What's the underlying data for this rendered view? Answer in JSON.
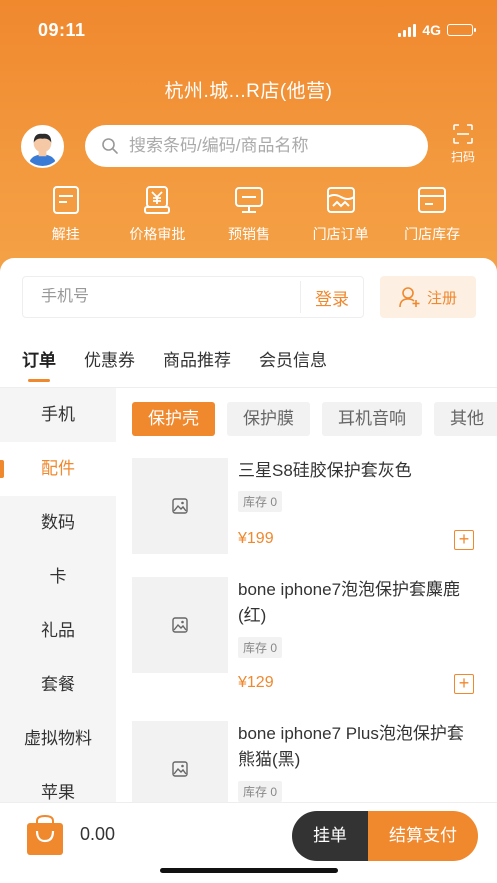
{
  "status_bar": {
    "time": "09:11",
    "network": "4G"
  },
  "header": {
    "store_name": "杭州.城...R店(他营)",
    "search_placeholder": "搜索条码/编码/商品名称",
    "scan_label": "扫码",
    "quick_actions": [
      {
        "label": "解挂",
        "icon": "document-icon"
      },
      {
        "label": "价格审批",
        "icon": "price-approval-icon"
      },
      {
        "label": "预销售",
        "icon": "monitor-icon"
      },
      {
        "label": "门店订单",
        "icon": "store-order-icon"
      },
      {
        "label": "门店库存",
        "icon": "store-stock-icon"
      }
    ]
  },
  "login": {
    "phone_placeholder": "手机号",
    "login_label": "登录",
    "register_label": "注册"
  },
  "tabs": [
    "订单",
    "优惠券",
    "商品推荐",
    "会员信息"
  ],
  "active_tab": "订单",
  "categories": [
    "手机",
    "配件",
    "数码",
    "卡",
    "礼品",
    "套餐",
    "虚拟物料",
    "苹果"
  ],
  "active_category": "配件",
  "subcategories": [
    "保护壳",
    "保护膜",
    "耳机音响",
    "其他"
  ],
  "active_subcategory": "保护壳",
  "products": [
    {
      "name": "三星S8硅胶保护套灰色",
      "stock": "库存 0",
      "price": "¥199"
    },
    {
      "name": "bone iphone7泡泡保护套麋鹿(红)",
      "stock": "库存 0",
      "price": "¥129"
    },
    {
      "name": "bone iphone7 Plus泡泡保护套熊猫(黑)",
      "stock": "库存 0",
      "price": ""
    }
  ],
  "footer": {
    "total": "0.00",
    "hang_label": "挂单",
    "pay_label": "结算支付"
  },
  "colors": {
    "accent": "#f0882e",
    "dark": "#333333"
  }
}
